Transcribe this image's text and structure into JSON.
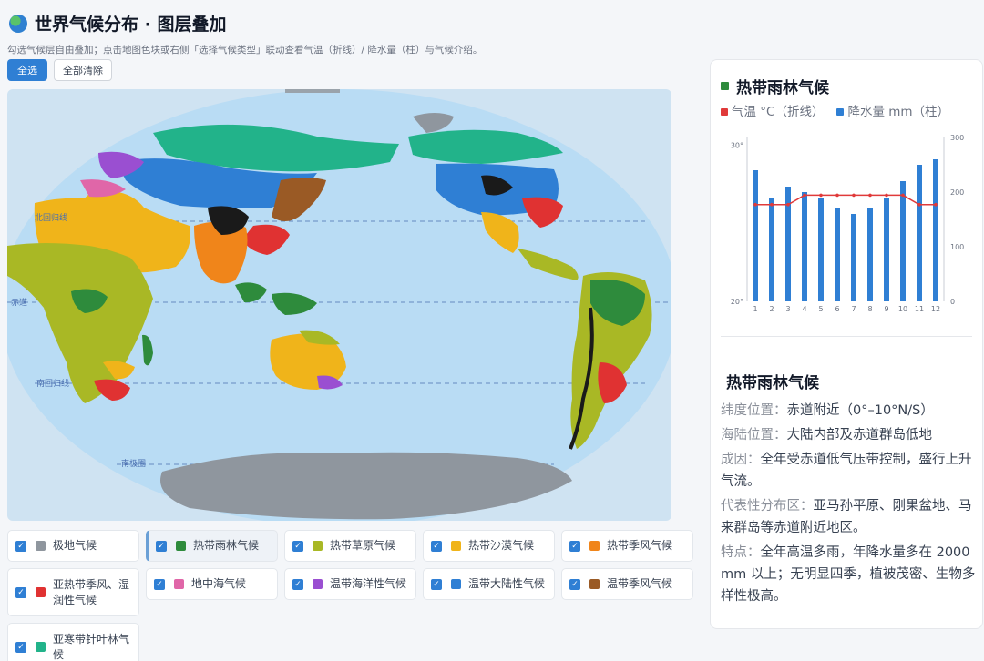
{
  "header": {
    "title": "世界气候分布 · 图层叠加",
    "subtitle": "勾选气候层自由叠加；点击地图色块或右侧「选择气候类型」联动查看气温（折线）/ 降水量（柱）与气候介绍。",
    "btn_all": "全选",
    "btn_clear": "全部清除"
  },
  "map": {
    "labels": {
      "north_tropic": "北回归线",
      "equator": "赤道",
      "south_tropic": "南回归线",
      "antarctic_circle": "南极圈"
    },
    "ocean_color": "#b9dcf4"
  },
  "legend": [
    {
      "label": "极地气候",
      "color": "#8f969e",
      "checked": true
    },
    {
      "label": "热带雨林气候",
      "color": "#2e8b3c",
      "checked": true,
      "active": true
    },
    {
      "label": "热带草原气候",
      "color": "#a9b825",
      "checked": true
    },
    {
      "label": "热带沙漠气候",
      "color": "#f0b41a",
      "checked": true
    },
    {
      "label": "热带季风气候",
      "color": "#f0851a",
      "checked": true
    },
    {
      "label": "亚热带季风、湿润性气候",
      "color": "#e03232",
      "checked": true
    },
    {
      "label": "地中海气候",
      "color": "#e066a8",
      "checked": true
    },
    {
      "label": "温带海洋性气候",
      "color": "#9a4fd1",
      "checked": true
    },
    {
      "label": "温带大陆性气候",
      "color": "#2f7fd4",
      "checked": true
    },
    {
      "label": "温带季风气候",
      "color": "#9a5a25",
      "checked": true
    },
    {
      "label": "亚寒带针叶林气候",
      "color": "#22b38a",
      "checked": true
    }
  ],
  "panel": {
    "title": "热带雨林气候",
    "legend_temp": "气温 °C（折线）",
    "legend_precip": "降水量 mm（柱）",
    "temp_color": "#e03a3a",
    "precip_color": "#2f7fd4"
  },
  "chart_data": {
    "type": "bar",
    "categories": [
      "1",
      "2",
      "3",
      "4",
      "5",
      "6",
      "7",
      "8",
      "9",
      "10",
      "11",
      "12"
    ],
    "series": [
      {
        "name": "降水量 mm（柱）",
        "type": "bar",
        "axis": "right",
        "values": [
          240,
          190,
          210,
          200,
          190,
          170,
          160,
          170,
          190,
          220,
          250,
          260
        ]
      },
      {
        "name": "气温 °C（折线）",
        "type": "line",
        "axis": "left",
        "values": [
          26.2,
          26.2,
          26.2,
          26.8,
          26.8,
          26.8,
          26.8,
          26.8,
          26.8,
          26.8,
          26.2,
          26.2
        ]
      }
    ],
    "left_axis": {
      "ticks": [
        "20°",
        "30°"
      ],
      "range": [
        20,
        30.5
      ]
    },
    "right_axis": {
      "ticks": [
        "0",
        "100",
        "200",
        "300"
      ],
      "range": [
        0,
        300
      ]
    }
  },
  "info": {
    "title": "热带雨林气候",
    "rows": [
      {
        "k": "纬度位置：",
        "v": "赤道附近（0°–10°N/S）"
      },
      {
        "k": "海陆位置：",
        "v": "大陆内部及赤道群岛低地"
      },
      {
        "k": "成因：",
        "v": "全年受赤道低气压带控制，盛行上升气流。"
      },
      {
        "k": "代表性分布区：",
        "v": "亚马孙平原、刚果盆地、马来群岛等赤道附近地区。"
      },
      {
        "k": "特点：",
        "v": "全年高温多雨，年降水量多在 2000 mm 以上；无明显四季，植被茂密、生物多样性极高。"
      }
    ]
  }
}
